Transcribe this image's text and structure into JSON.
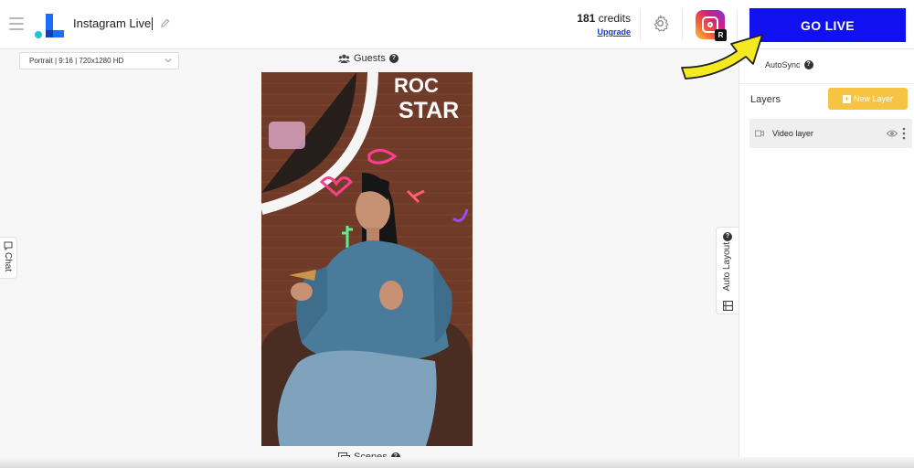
{
  "header": {
    "title": "Instagram Live",
    "credits_count": "181",
    "credits_word": "credits",
    "upgrade_label": "Upgrade",
    "instagram_badge": "R",
    "go_live_label": "GO LIVE"
  },
  "toolbar": {
    "resolution_value": "Portrait | 9:16 | 720x1280 HD",
    "guests_label": "Guests",
    "scenes_label": "Scenes"
  },
  "canvas": {
    "neon_text_top": "ROC",
    "neon_text_bottom": "STAR"
  },
  "side_tabs": {
    "chat_label": "Chat",
    "auto_layout_label": "Auto Layout"
  },
  "right_panel": {
    "autosync_label": "AutoSync",
    "layers_label": "Layers",
    "new_layer_label": "New Layer",
    "layers": [
      {
        "name": "Video layer"
      }
    ]
  },
  "help_glyph": "?",
  "colors": {
    "go_live": "#1010f0",
    "new_layer": "#f6c343",
    "annotation_arrow": "#f4ea1f",
    "upgrade_link": "#1a38b8"
  },
  "icons": [
    "menu-icon",
    "logo",
    "pencil-icon",
    "gear-icon",
    "instagram-icon",
    "guests-icon",
    "help-icon",
    "scenes-icon",
    "chat-icon",
    "film-icon",
    "video-camera-icon",
    "eye-icon",
    "kebab-icon",
    "chevron-down-icon",
    "plus-icon",
    "arrow-annotation"
  ]
}
